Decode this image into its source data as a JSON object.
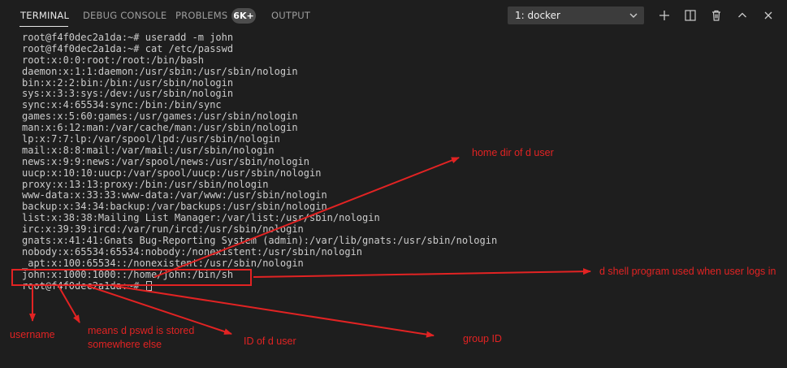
{
  "panel": {
    "tabs": [
      {
        "label": "TERMINAL"
      },
      {
        "label": "DEBUG CONSOLE"
      },
      {
        "label": "PROBLEMS"
      },
      {
        "label": "OUTPUT"
      }
    ],
    "problems_badge": "6K+",
    "terminal_select": "1: docker",
    "icons": [
      "add-icon",
      "split-icon",
      "trash-icon",
      "chevron-up-icon",
      "close-icon"
    ]
  },
  "terminal": {
    "lines": [
      "root@f4f0dec2a1da:~# useradd -m john",
      "root@f4f0dec2a1da:~# cat /etc/passwd",
      "root:x:0:0:root:/root:/bin/bash",
      "daemon:x:1:1:daemon:/usr/sbin:/usr/sbin/nologin",
      "bin:x:2:2:bin:/bin:/usr/sbin/nologin",
      "sys:x:3:3:sys:/dev:/usr/sbin/nologin",
      "sync:x:4:65534:sync:/bin:/bin/sync",
      "games:x:5:60:games:/usr/games:/usr/sbin/nologin",
      "man:x:6:12:man:/var/cache/man:/usr/sbin/nologin",
      "lp:x:7:7:lp:/var/spool/lpd:/usr/sbin/nologin",
      "mail:x:8:8:mail:/var/mail:/usr/sbin/nologin",
      "news:x:9:9:news:/var/spool/news:/usr/sbin/nologin",
      "uucp:x:10:10:uucp:/var/spool/uucp:/usr/sbin/nologin",
      "proxy:x:13:13:proxy:/bin:/usr/sbin/nologin",
      "www-data:x:33:33:www-data:/var/www:/usr/sbin/nologin",
      "backup:x:34:34:backup:/var/backups:/usr/sbin/nologin",
      "list:x:38:38:Mailing List Manager:/var/list:/usr/sbin/nologin",
      "irc:x:39:39:ircd:/var/run/ircd:/usr/sbin/nologin",
      "gnats:x:41:41:Gnats Bug-Reporting System (admin):/var/lib/gnats:/usr/sbin/nologin",
      "nobody:x:65534:65534:nobody:/nonexistent:/usr/sbin/nologin",
      "_apt:x:100:65534::/nonexistent:/usr/sbin/nologin",
      "john:x:1000:1000::/home/john:/bin/sh",
      "root@f4f0dec2a1da:~# "
    ]
  },
  "annotations": {
    "home_dir": "home dir of d user",
    "shell": "d shell program used when user logs in",
    "username": "username",
    "password": "means d pswd is stored somewhere else",
    "user_id": "ID of d user",
    "group_id": "group ID"
  },
  "colors": {
    "background": "#1e1e1e",
    "terminal_text": "#cccccc",
    "annotation_red": "#e22323",
    "tab_active": "#e7e7e7",
    "tab_inactive": "#9d9d9d"
  }
}
